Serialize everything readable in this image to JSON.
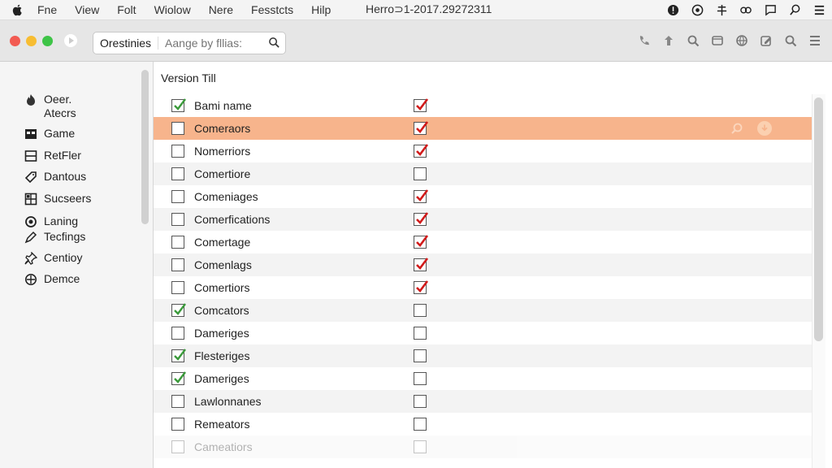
{
  "menubar": {
    "items": [
      "Fne",
      "View",
      "Folt",
      "Wiolow",
      "Nere",
      "Fesstcts",
      "Hilp"
    ],
    "title": "Herro⊃1-2017.29272311",
    "right_icons": [
      "info-icon",
      "compass-icon",
      "network-icon",
      "link-icon",
      "chat-icon",
      "search-icon",
      "menu-icon"
    ]
  },
  "toolbar": {
    "search_scope": "Orestinies",
    "search_placeholder": "Aange by fllias:",
    "right_icons": [
      "phone-icon",
      "up-icon",
      "zoom-icon",
      "window-icon",
      "globe-icon",
      "edit-icon",
      "search-icon",
      "list-icon"
    ]
  },
  "sidebar": {
    "items": [
      {
        "label": "Oeer.\nAtecrs",
        "icon": "flame-icon"
      },
      {
        "label": "Game",
        "icon": "monitor-icon"
      },
      {
        "label": "RetFler",
        "icon": "box-icon"
      },
      {
        "label": "Dantous",
        "icon": "tag-icon"
      },
      {
        "label": "Sucseers",
        "icon": "grid-icon"
      },
      {
        "label": "Laning",
        "icon": "target-icon"
      },
      {
        "label": "Tecfings",
        "icon": "pen-icon"
      },
      {
        "label": "Centioy",
        "icon": "pin-icon"
      },
      {
        "label": "Demce",
        "icon": "plus-circle-icon"
      }
    ]
  },
  "main": {
    "column_title": "Version Till",
    "rows": [
      {
        "name": "Bami name",
        "check1": "green",
        "check2": "red"
      },
      {
        "name": "Comeraors",
        "check1": "none",
        "check2": "red",
        "selected": true
      },
      {
        "name": "Nomerriors",
        "check1": "none",
        "check2": "red"
      },
      {
        "name": "Comertiore",
        "check1": "none",
        "check2": "none"
      },
      {
        "name": "Comeniages",
        "check1": "none",
        "check2": "red"
      },
      {
        "name": "Comerfications",
        "check1": "none",
        "check2": "red"
      },
      {
        "name": "Comertage",
        "check1": "none",
        "check2": "red"
      },
      {
        "name": "Comenlags",
        "check1": "none",
        "check2": "red"
      },
      {
        "name": "Comertiors",
        "check1": "none",
        "check2": "red"
      },
      {
        "name": "Comcators",
        "check1": "green",
        "check2": "none"
      },
      {
        "name": "Dameriges",
        "check1": "none",
        "check2": "none"
      },
      {
        "name": "Flesteriges",
        "check1": "green",
        "check2": "none"
      },
      {
        "name": "Dameriges",
        "check1": "green",
        "check2": "none"
      },
      {
        "name": "Lawlonnanes",
        "check1": "none",
        "check2": "none"
      },
      {
        "name": "Remeators",
        "check1": "none",
        "check2": "none"
      },
      {
        "name": "Cameatiors",
        "check1": "none",
        "check2": "none",
        "faded": true
      }
    ]
  },
  "colors": {
    "selection": "#f7b48c",
    "check_green": "#3a9a3a",
    "check_red": "#d11a1a"
  }
}
